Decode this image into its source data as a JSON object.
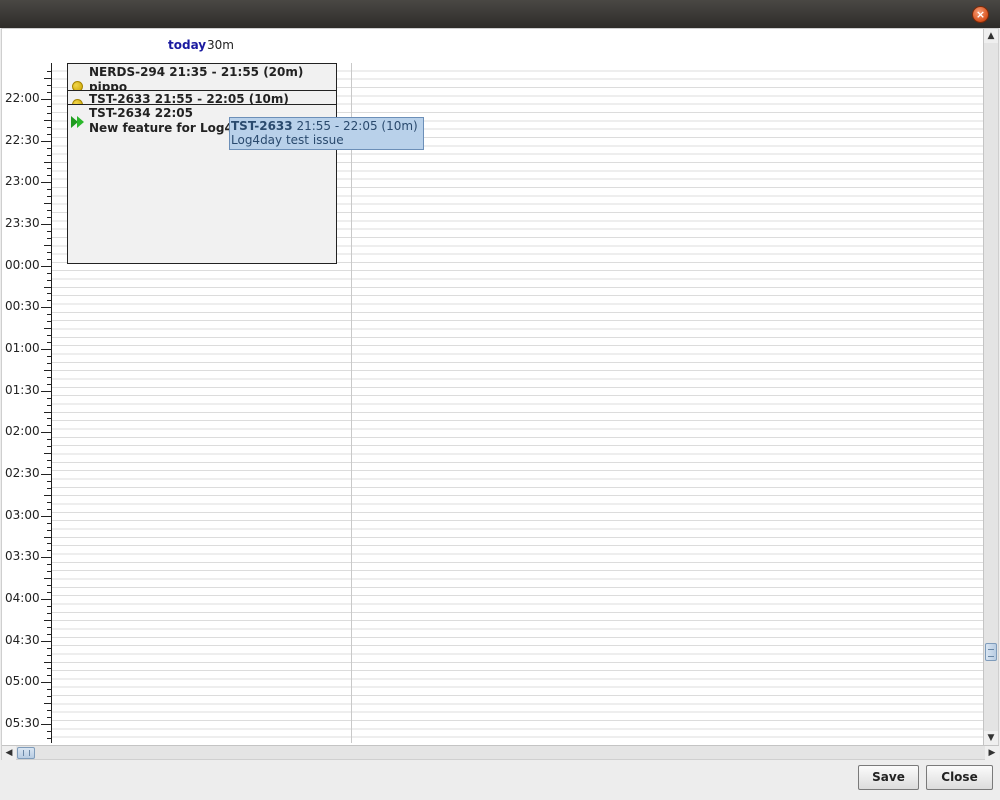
{
  "window": {
    "close_glyph": "×"
  },
  "header": {
    "date_label": "today",
    "duration_label": "30m"
  },
  "ruler": {
    "labels": [
      "22:00",
      "22:30",
      "23:00",
      "23:30",
      "00:00",
      "00:30",
      "01:00",
      "01:30",
      "02:00",
      "02:30",
      "03:00",
      "03:30",
      "04:00",
      "04:30",
      "05:00",
      "05:30"
    ]
  },
  "tasks": [
    {
      "title": "NERDS-294 21:35 - 21:55 (20m)",
      "subtitle": "pippo",
      "icon": "yellow-dot-icon"
    },
    {
      "title": "TST-2633 21:55 - 22:05 (10m)",
      "icon": "yellow-dot-icon"
    },
    {
      "title": "TST-2634 22:05",
      "subtitle": "New feature for Log4d",
      "icon": "green-play-icon"
    }
  ],
  "tooltip": {
    "id": "TST-2633",
    "time": "21:55 - 22:05 (10m)",
    "description": "Log4day test issue"
  },
  "buttons": {
    "save": "Save",
    "close": "Close"
  },
  "colors": {
    "tooltip_bg": "#b9d1ea",
    "date_label": "#1a1aa0"
  }
}
